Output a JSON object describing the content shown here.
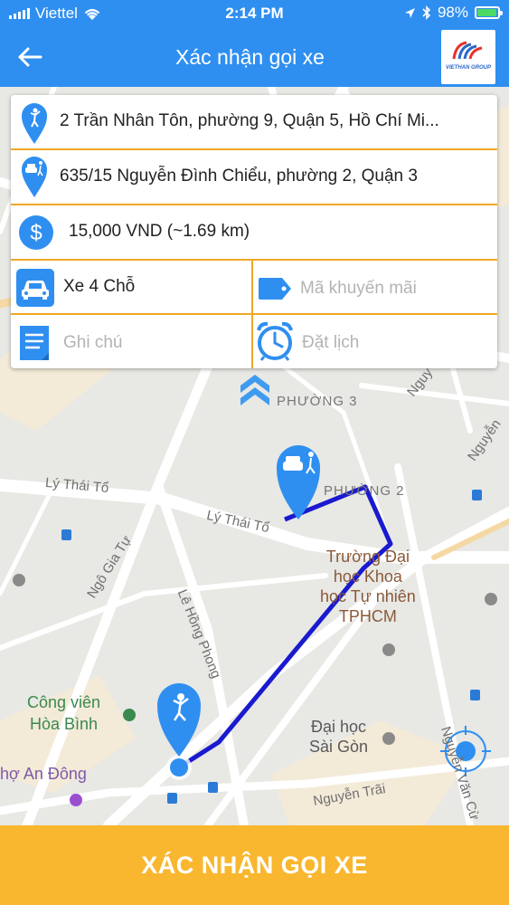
{
  "status_bar": {
    "carrier": "Viettel",
    "time": "2:14 PM",
    "battery": "98%"
  },
  "header": {
    "title": "Xác nhận gọi xe",
    "logo_text": "VIETHAN GROUP"
  },
  "trip": {
    "pickup": "2 Trần Nhân Tôn, phường 9, Quận 5, Hồ Chí Mi...",
    "dropoff": "635/15 Nguyễn Đình Chiểu, phường 2, Quận 3",
    "price": "15,000 VND (~1.69 km)",
    "vehicle": "Xe 4 Chỗ",
    "promo_placeholder": "Mã khuyến mãi",
    "note_placeholder": "Ghi chú",
    "schedule_placeholder": "Đặt lịch"
  },
  "map": {
    "wards": {
      "p3": "PHƯỜNG 3",
      "p2": "PHƯỜNG 2"
    },
    "streets": {
      "ly_thai_to_1": "Lý Thái Tổ",
      "ly_thai_to_2": "Lý Thái Tổ",
      "ngo_gia_tu": "Ngô Gia Tự",
      "le_hong_phong": "Lê Hồng Phong",
      "nguyen_trai": "Nguyễn Trãi",
      "nguyen_van_cu": "Nguyễn Văn Cừ",
      "nguy": "Nguy",
      "nguyen": "Nguyễn"
    },
    "pois": {
      "dh_khtn": "Trường Đại\nhọc Khoa\nhọc Tự nhiên\nTPHCM",
      "dh_sai_gon": "Đại học\nSài Gòn",
      "cong_vien": "Công viên\nHòa Bình",
      "cho_an_dong": "hợ An Đông"
    }
  },
  "actions": {
    "confirm": "XÁC NHẬN GỌI XE"
  },
  "colors": {
    "primary": "#2f8ff0",
    "accent": "#f8b72e",
    "route": "#1a1acf",
    "divider": "#f0a825"
  }
}
